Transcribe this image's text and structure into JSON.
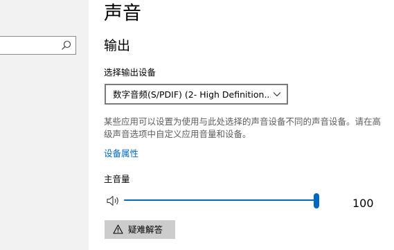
{
  "sidebar": {
    "search": {
      "value": "",
      "icon": "search-icon"
    }
  },
  "header": {
    "title": "声音"
  },
  "output": {
    "heading": "输出",
    "device_label": "选择输出设备",
    "selected_device": "数字音频(S/PDIF) (2- High Definition...",
    "dropdown_icon": "chevron-down-icon",
    "description": "某些应用可以设置为使用与此处选择的声音设备不同的声音设备。请在高级声音选项中自定义应用音量和设备。",
    "device_properties_link": "设备属性",
    "master_volume_label": "主音量",
    "speaker_icon": "speaker-icon",
    "volume_value": "100",
    "volume_level_percent": 100,
    "troubleshoot_label": "疑难解答",
    "troubleshoot_icon": "warning-icon"
  },
  "colors": {
    "accent": "#0067c0",
    "sidebar_background": "#f2f2f2",
    "secondary_text": "#5d5d5d",
    "button_background": "#cccccc"
  }
}
